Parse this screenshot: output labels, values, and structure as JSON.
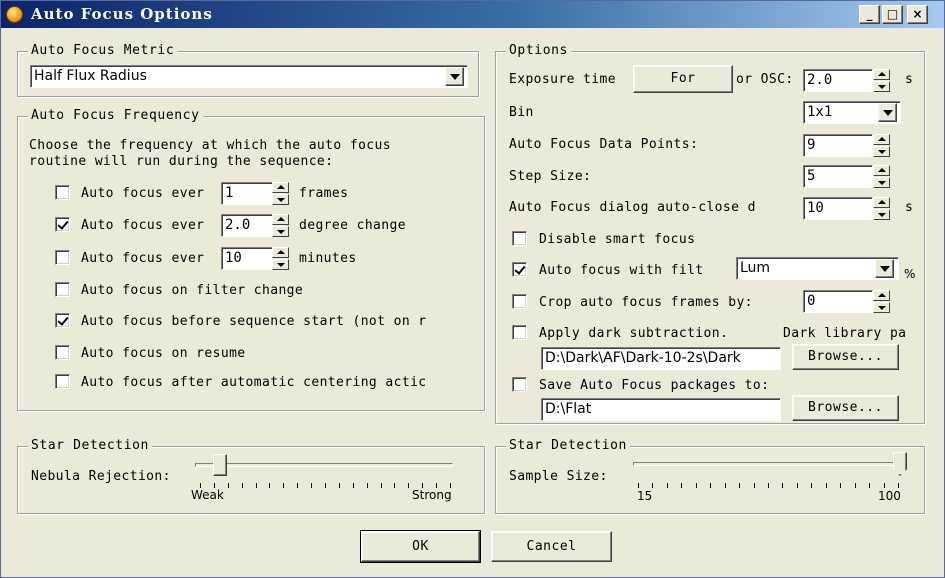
{
  "window": {
    "title": "Auto Focus Options",
    "controls": {
      "minimize": "_",
      "maximize": "□",
      "close": "×"
    }
  },
  "metric": {
    "legend": "Auto Focus Metric",
    "selected": "Half Flux Radius"
  },
  "frequency": {
    "legend": "Auto Focus Frequency",
    "description_line1": "Choose the frequency at which the auto focus",
    "description_line2": "routine will run during the sequence:",
    "every_frames": {
      "label": "Auto focus ever",
      "checked": false,
      "value": "1",
      "suffix": "frames"
    },
    "every_degree": {
      "label": "Auto focus ever",
      "checked": true,
      "value": "2.0",
      "suffix": "degree change"
    },
    "every_minutes": {
      "label": "Auto focus ever",
      "checked": false,
      "value": "10",
      "suffix": "minutes"
    },
    "on_filter_change": {
      "label": "Auto focus on filter change",
      "checked": false
    },
    "before_sequence": {
      "label": "Auto focus before sequence start (not on r",
      "checked": true
    },
    "on_resume": {
      "label": "Auto focus on resume",
      "checked": false
    },
    "after_centering": {
      "label": "Auto focus after automatic centering actic",
      "checked": false
    }
  },
  "star_left": {
    "legend": "Star Detection",
    "label": "Nebula Rejection:",
    "min_label": "Weak",
    "max_label": "Strong",
    "level": 0.08
  },
  "options": {
    "legend": "Options",
    "exposure_label": "Exposure time",
    "for_button": "For",
    "osc_label": "or OSC:",
    "exposure_value": "2.0",
    "exposure_unit": "s",
    "bin_label": "Bin",
    "bin_value": "1x1",
    "data_points_label": "Auto Focus Data Points:",
    "data_points_value": "9",
    "step_label": "Step Size:",
    "step_value": "5",
    "autoclose_label": "Auto Focus dialog auto-close d",
    "autoclose_value": "10",
    "autoclose_unit": "s",
    "disable_smart": {
      "label": "Disable smart focus",
      "checked": false
    },
    "with_filter": {
      "label": "Auto focus with filt",
      "checked": true,
      "value": "Lum",
      "suffix": "%"
    },
    "crop": {
      "label": "Crop auto focus frames by:",
      "checked": false,
      "value": "0"
    },
    "dark": {
      "label": "Apply dark subtraction.",
      "library_label": "Dark library pa",
      "checked": false,
      "path": "D:\\Dark\\AF\\Dark-10-2s\\Dark",
      "browse": "Browse..."
    },
    "save": {
      "label": "Save Auto Focus packages to:",
      "checked": false,
      "path": "D:\\Flat",
      "browse": "Browse..."
    }
  },
  "star_right": {
    "legend": "Star Detection",
    "label": "Sample Size:",
    "min_label": "15",
    "max_label": "100",
    "level": 1.0
  },
  "footer": {
    "ok": "OK",
    "cancel": "Cancel"
  }
}
